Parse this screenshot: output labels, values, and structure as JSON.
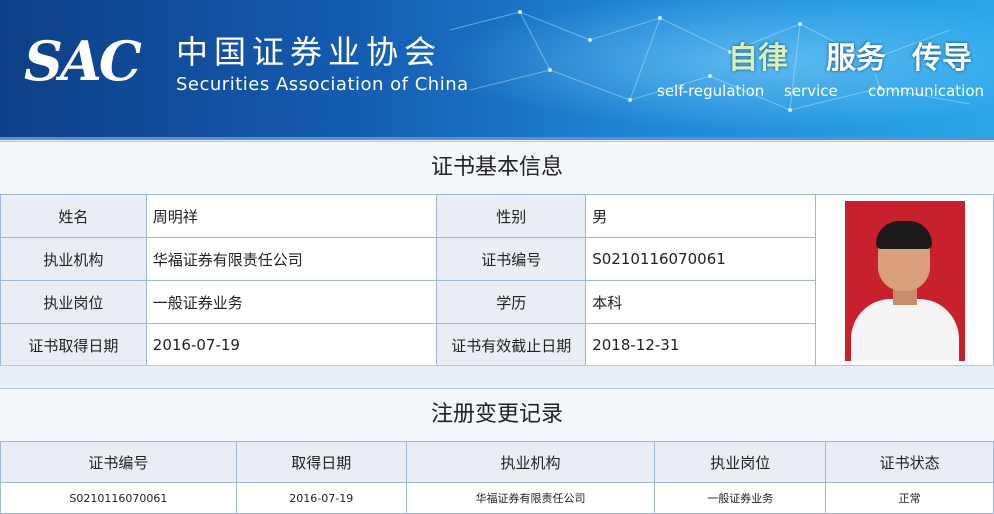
{
  "header": {
    "logo_text": "SAC",
    "org_name_cn": "中国证券业协会",
    "org_name_en": "Securities Association of China",
    "slogans": [
      {
        "zh": "自律",
        "en": "self-regulation"
      },
      {
        "zh": "服务",
        "en": "service"
      },
      {
        "zh": "传导",
        "en": "communication"
      }
    ]
  },
  "cert_info": {
    "title": "证书基本信息",
    "rows": [
      {
        "label1": "姓名",
        "value1": "周明祥",
        "label2": "性别",
        "value2": "男"
      },
      {
        "label1": "执业机构",
        "value1": "华福证券有限责任公司",
        "label2": "证书编号",
        "value2": "S0210116070061"
      },
      {
        "label1": "执业岗位",
        "value1": "一般证券业务",
        "label2": "学历",
        "value2": "本科"
      },
      {
        "label1": "证书取得日期",
        "value1": "2016-07-19",
        "label2": "证书有效截止日期",
        "value2": "2018-12-31"
      }
    ]
  },
  "registration": {
    "title": "注册变更记录",
    "columns": [
      "证书编号",
      "取得日期",
      "执业机构",
      "执业岗位",
      "证书状态"
    ],
    "rows": [
      [
        "S0210116070061",
        "2016-07-19",
        "华福证券有限责任公司",
        "一般证券业务",
        "正常"
      ]
    ]
  },
  "colors": {
    "banner_dark": "#0d3f86",
    "banner_light": "#2aa6ea",
    "table_border": "#9fb6d6",
    "label_bg": "#e9eef5",
    "photo_bg": "#c9202e"
  }
}
